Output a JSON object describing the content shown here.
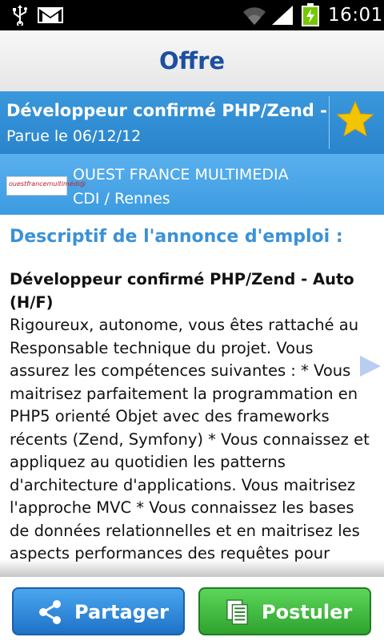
{
  "status_bar": {
    "time": "16:01",
    "icons": [
      "usb-icon",
      "gmail-icon",
      "wifi-icon",
      "signal-icon",
      "battery-charging-icon"
    ]
  },
  "page_title": "Offre",
  "job": {
    "title": "Développeur confirmé PHP/Zend -.",
    "date": "Parue le 06/12/12"
  },
  "company": {
    "logo_text": "ouestfrancemultimédi@",
    "name": "OUEST FRANCE MULTIMEDIA",
    "contract": "CDI / Rennes"
  },
  "description": {
    "heading": "Descriptif de l'annonce d'emploi :",
    "title": "Développeur confirmé PHP/Zend - Auto (H/F)",
    "body": "Rigoureux, autonome, vous êtes rattaché au Responsable technique du projet. Vous assurez les compétences suivantes : * Vous maitrisez parfaitement la programmation en PHP5 orienté Objet avec des frameworks récents (Zend, Symfony) * Vous connaissez et appliquez au quotidien les patterns d'architecture d'applications. Vous maitrisez l'approche MVC * Vous connaissez les bases de données relationnelles et en maitrisez les aspects performances des requêtes pour"
  },
  "buttons": {
    "share": "Partager",
    "apply": "Postuler"
  },
  "colors": {
    "title": "#1d4fa0",
    "header_blue": "#2a84cc",
    "company_blue": "#3c9be0",
    "heading_blue": "#3a92d8",
    "share_button": "#1f72c8",
    "apply_button": "#2ea32e",
    "star": "#f5c400"
  }
}
